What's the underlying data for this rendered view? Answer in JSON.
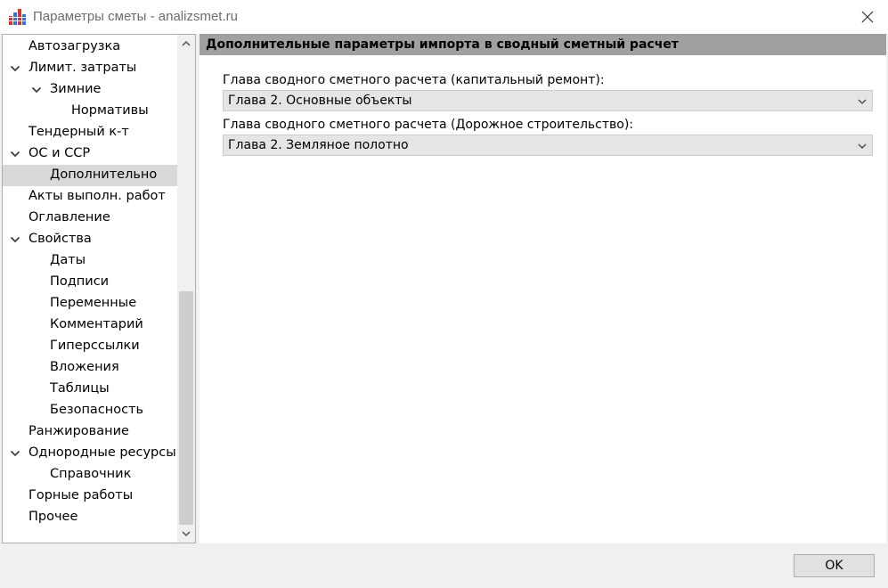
{
  "window": {
    "title": "Параметры сметы - analizsmet.ru"
  },
  "tree": {
    "items": [
      {
        "label": "Автозагрузка",
        "level": 0,
        "expandable": false,
        "selected": false
      },
      {
        "label": "Лимит. затраты",
        "level": 0,
        "expandable": true,
        "selected": false
      },
      {
        "label": "Зимние",
        "level": 1,
        "expandable": true,
        "selected": false
      },
      {
        "label": "Нормативы",
        "level": 2,
        "expandable": false,
        "selected": false
      },
      {
        "label": "Тендерный к-т",
        "level": 0,
        "expandable": false,
        "selected": false
      },
      {
        "label": "ОС и ССР",
        "level": 0,
        "expandable": true,
        "selected": false
      },
      {
        "label": "Дополнительно",
        "level": 1,
        "expandable": false,
        "selected": true
      },
      {
        "label": "Акты выполн. работ",
        "level": 0,
        "expandable": false,
        "selected": false
      },
      {
        "label": "Оглавление",
        "level": 0,
        "expandable": false,
        "selected": false
      },
      {
        "label": "Свойства",
        "level": 0,
        "expandable": true,
        "selected": false
      },
      {
        "label": "Даты",
        "level": 1,
        "expandable": false,
        "selected": false
      },
      {
        "label": "Подписи",
        "level": 1,
        "expandable": false,
        "selected": false
      },
      {
        "label": "Переменные",
        "level": 1,
        "expandable": false,
        "selected": false
      },
      {
        "label": "Комментарий",
        "level": 1,
        "expandable": false,
        "selected": false
      },
      {
        "label": "Гиперссылки",
        "level": 1,
        "expandable": false,
        "selected": false
      },
      {
        "label": "Вложения",
        "level": 1,
        "expandable": false,
        "selected": false
      },
      {
        "label": "Таблицы",
        "level": 1,
        "expandable": false,
        "selected": false
      },
      {
        "label": "Безопасность",
        "level": 1,
        "expandable": false,
        "selected": false
      },
      {
        "label": "Ранжирование",
        "level": 0,
        "expandable": false,
        "selected": false
      },
      {
        "label": "Однородные ресурсы",
        "level": 0,
        "expandable": true,
        "selected": false
      },
      {
        "label": "Справочник",
        "level": 1,
        "expandable": false,
        "selected": false
      },
      {
        "label": "Горные работы",
        "level": 0,
        "expandable": false,
        "selected": false
      },
      {
        "label": "Прочее",
        "level": 0,
        "expandable": false,
        "selected": false
      }
    ]
  },
  "panel": {
    "header": "Дополнительные параметры импорта в сводный сметный расчет",
    "fields": [
      {
        "label": "Глава сводного сметного расчета (капитальный ремонт):",
        "value": "Глава 2. Основные объекты"
      },
      {
        "label": "Глава сводного сметного расчета (Дорожное строительство):",
        "value": "Глава 2. Земляное полотно"
      }
    ]
  },
  "buttons": {
    "ok_label": "OK"
  }
}
